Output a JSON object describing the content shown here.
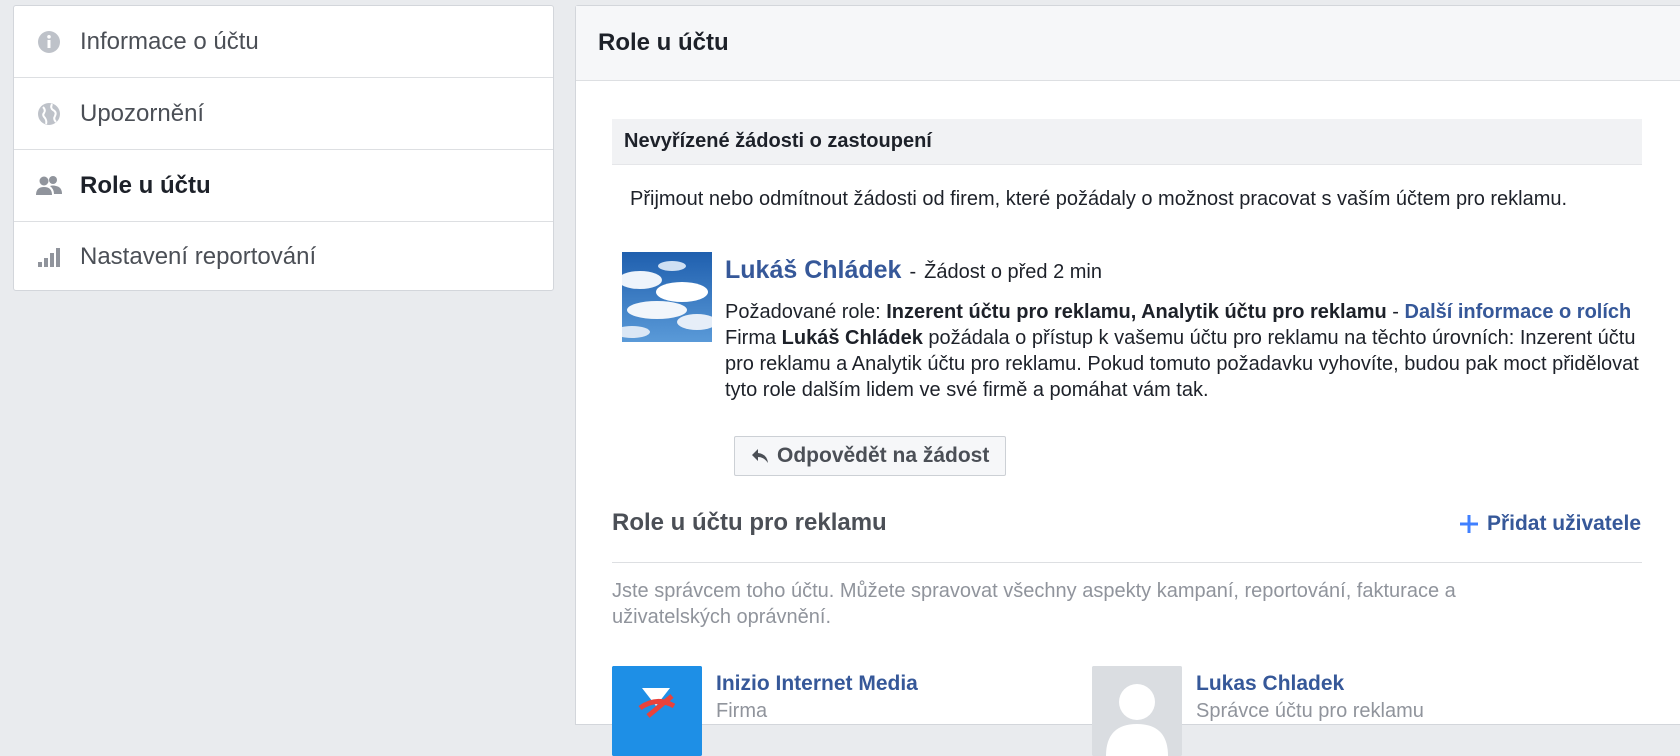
{
  "sidebar": {
    "items": [
      {
        "label": "Informace o účtu",
        "icon": "info-icon",
        "active": false
      },
      {
        "label": "Upozornění",
        "icon": "globe-icon",
        "active": false
      },
      {
        "label": "Role u účtu",
        "icon": "people-icon",
        "active": true
      },
      {
        "label": "Nastavení reportování",
        "icon": "bar-chart-icon",
        "active": false
      }
    ]
  },
  "main": {
    "title": "Role u účtu",
    "pending": {
      "title": "Nevyřízené žádosti o zastoupení",
      "intro": "Přijmout nebo odmítnout žádosti od firem, které požádaly o možnost pracovat s vaším účtem pro reklamu.",
      "request": {
        "name": "Lukáš Chládek",
        "separator": "-",
        "time": "Žádost o před 2 min",
        "roles_label": "Požadované role:",
        "roles_value": "Inzerent účtu pro reklamu, Analytik účtu pro reklamu",
        "roles_sep": "-",
        "roles_link": "Další informace o rolích",
        "desc_prefix": "Firma",
        "desc_name": "Lukáš Chládek",
        "desc_rest": "požádala o přístup k vašemu účtu pro reklamu na těchto úrovních: Inzerent účtu pro reklamu a Analytik účtu pro reklamu. Pokud tomuto požadavku vyhovíte, budou pak moct přidělovat tyto role dalším lidem ve své firmě a pomáhat vám tak.",
        "respond_label": "Odpovědět na žádost"
      }
    },
    "roles": {
      "title": "Role u účtu pro reklamu",
      "add_user_label": "Přidat uživatele",
      "admin_note": "Jste správcem toho účtu. Můžete spravovat všechny aspekty kampaní, reportování, fakturace a uživatelských oprávnění.",
      "users": [
        {
          "name": "Inizio Internet Media",
          "role": "Firma"
        },
        {
          "name": "Lukas Chladek",
          "role": "Správce účtu pro reklamu"
        }
      ]
    }
  },
  "colors": {
    "link": "#365899",
    "background": "#e9ebee",
    "accent_blue": "#4080ff",
    "inizio_blue": "#1e8fe6"
  }
}
